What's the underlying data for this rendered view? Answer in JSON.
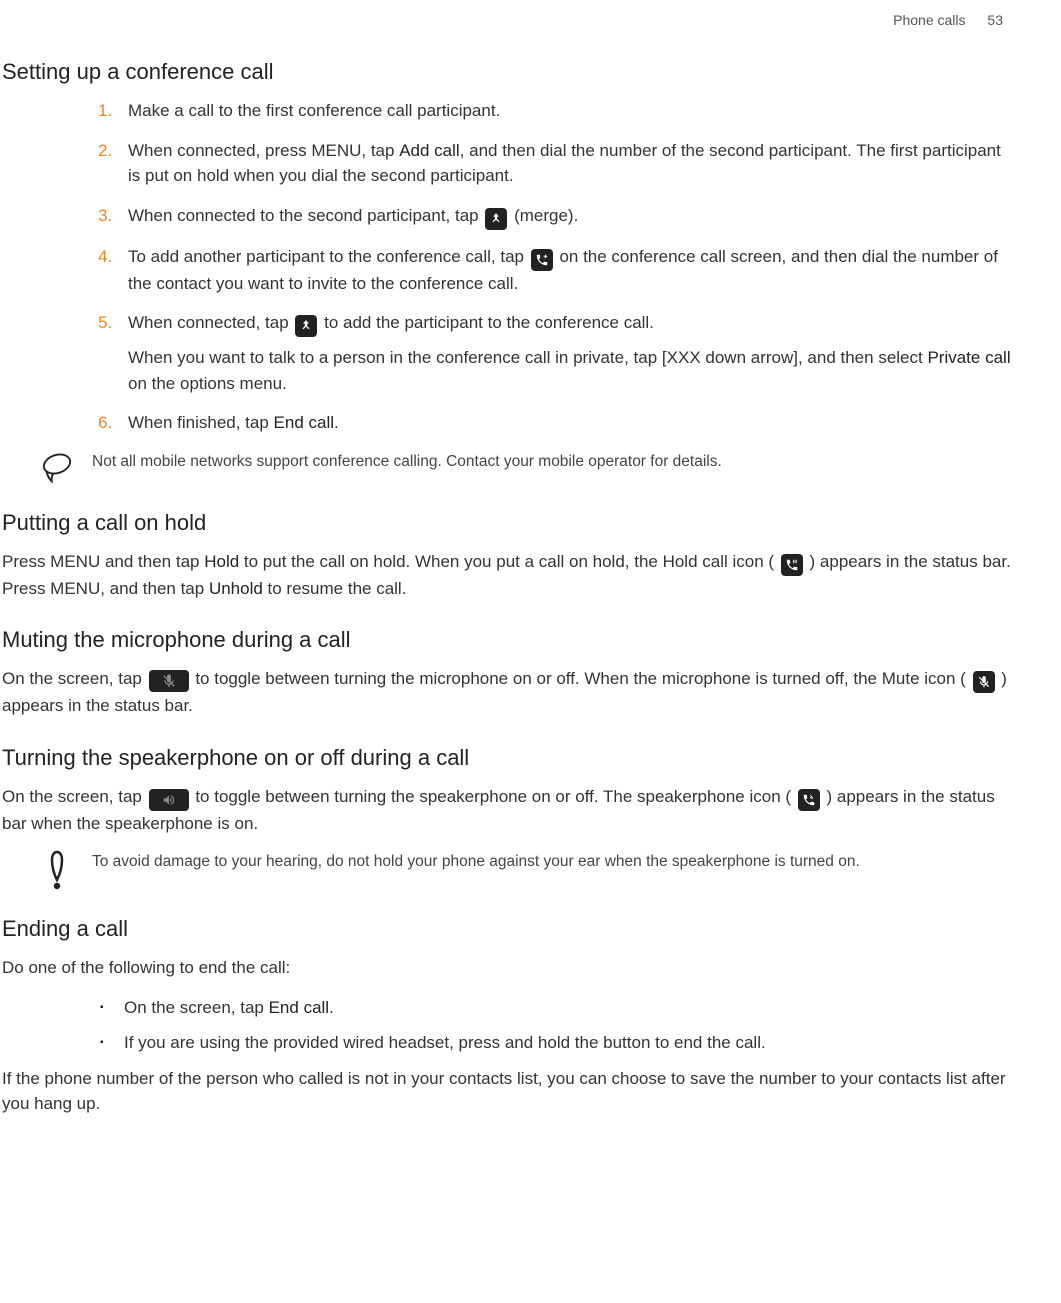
{
  "header": {
    "section": "Phone calls",
    "page": "53"
  },
  "s1": {
    "title": "Setting up a conference call",
    "steps": {
      "n1": "1.",
      "t1": "Make a call to the first conference call participant.",
      "n2": "2.",
      "t2a": "When connected, press MENU, tap ",
      "t2b": "Add call",
      "t2c": ", and then dial the number of the second participant. The first participant is put on hold when you dial the second participant.",
      "n3": "3.",
      "t3a": "When connected to the second participant, tap ",
      "t3b": " (merge).",
      "n4": "4.",
      "t4a": "To add another participant to the conference call, tap ",
      "t4b": " on the conference call screen, and then dial the number of the contact you want to invite to the conference call.",
      "n5": "5.",
      "t5a": "When connected, tap ",
      "t5b": " to add the participant to the conference call.",
      "t5c": "When you want to talk to a person in the conference call in private, tap [XXX down arrow], and then select ",
      "t5d": "Private call",
      "t5e": " on the options menu.",
      "n6": "6.",
      "t6a": "When finished, tap ",
      "t6b": "End call",
      "t6c": "."
    },
    "note": "Not all mobile networks support conference calling. Contact your mobile operator for details."
  },
  "s2": {
    "title": "Putting a call on hold",
    "pA": "Press MENU and then tap ",
    "pB": "Hold",
    "pC": " to put the call on hold. When you put a call on hold, the Hold call icon ( ",
    "pD": " ) appears in the status bar. Press MENU, and then tap ",
    "pE": "Unhold",
    "pF": " to resume the call."
  },
  "s3": {
    "title": "Muting the microphone during a call",
    "pA": "On the screen, tap ",
    "pB": " to toggle between turning the microphone on or off. When the microphone is turned off, the Mute icon ( ",
    "pC": " ) appears in the status bar."
  },
  "s4": {
    "title": "Turning the speakerphone on or off during a call",
    "pA": "On the screen, tap ",
    "pB": " to toggle between turning the speakerphone on or off. The speakerphone icon ( ",
    "pC": " ) appears in the status bar when the speakerphone is on.",
    "warn": "To avoid damage to your hearing, do not hold your phone against your ear when the speakerphone is turned on."
  },
  "s5": {
    "title": "Ending a call",
    "intro": "Do one of the following to end the call:",
    "b1a": "On the screen, tap ",
    "b1b": "End call",
    "b1c": ".",
    "b2": "If you are using the provided wired headset, press and hold the button to end the call.",
    "outro": "If the phone number of the person who called is not in your contacts list, you can choose to save the number to your contacts list after you hang up."
  }
}
